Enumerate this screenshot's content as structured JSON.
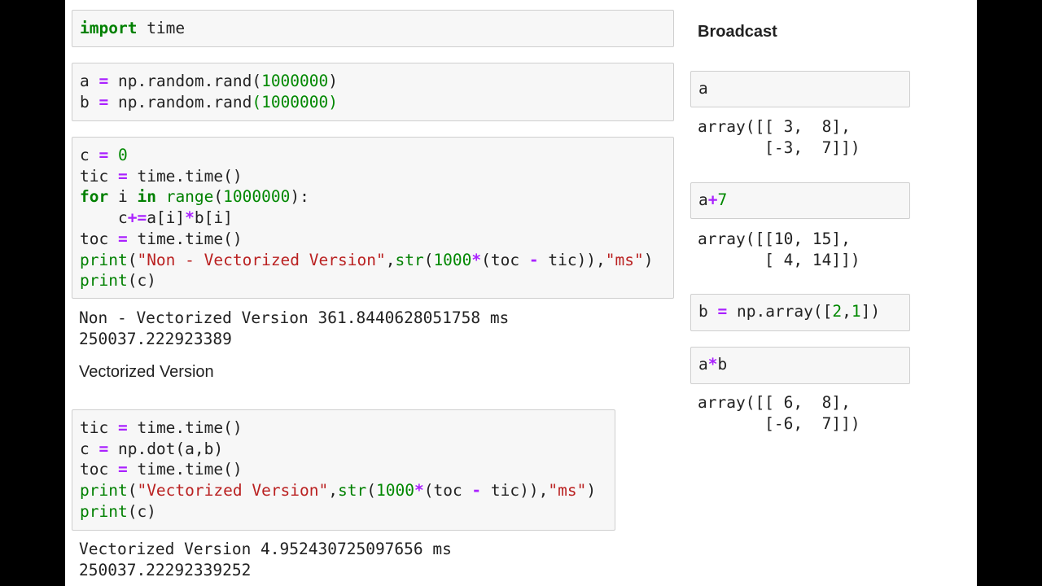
{
  "left": {
    "cells": [
      {
        "lines": [
          [
            [
              "import",
              "kw"
            ],
            [
              " time",
              ""
            ]
          ]
        ]
      },
      {
        "lines": [
          [
            [
              "a ",
              ""
            ],
            [
              "=",
              "op"
            ],
            [
              " np.random.rand(",
              ""
            ],
            [
              "1000000",
              "num"
            ],
            [
              ")",
              ""
            ]
          ],
          [
            [
              "b ",
              ""
            ],
            [
              "=",
              "op"
            ],
            [
              " np.random.rand",
              ""
            ],
            [
              "(1000000)",
              "num"
            ]
          ]
        ]
      },
      {
        "lines": [
          [
            [
              "c ",
              ""
            ],
            [
              "=",
              "op"
            ],
            [
              " ",
              ""
            ],
            [
              "0",
              "num"
            ]
          ],
          [
            [
              "tic ",
              ""
            ],
            [
              "=",
              "op"
            ],
            [
              " time.time()",
              ""
            ]
          ],
          [
            [
              "for",
              "kw"
            ],
            [
              " i ",
              ""
            ],
            [
              "in",
              "kw"
            ],
            [
              " ",
              ""
            ],
            [
              "range",
              "bi"
            ],
            [
              "(",
              ""
            ],
            [
              "1000000",
              "num"
            ],
            [
              "):",
              ""
            ]
          ],
          [
            [
              "    c",
              ""
            ],
            [
              "+=",
              "op"
            ],
            [
              "a[i]",
              ""
            ],
            [
              "*",
              "op"
            ],
            [
              "b[i]",
              ""
            ]
          ],
          [
            [
              "toc ",
              ""
            ],
            [
              "=",
              "op"
            ],
            [
              " time.time()",
              ""
            ]
          ],
          [
            [
              "print",
              "bi"
            ],
            [
              "(",
              ""
            ],
            [
              "\"Non - Vectorized Version\"",
              "str"
            ],
            [
              ",",
              ""
            ],
            [
              "str",
              "bi"
            ],
            [
              "(",
              ""
            ],
            [
              "1000",
              "num"
            ],
            [
              "*",
              "op"
            ],
            [
              "(toc ",
              ""
            ],
            [
              "-",
              "op"
            ],
            [
              " tic)),",
              ""
            ],
            [
              "\"ms\"",
              "str"
            ],
            [
              ")",
              ""
            ]
          ],
          [
            [
              "print",
              "bi"
            ],
            [
              "(c)",
              ""
            ]
          ]
        ]
      },
      {
        "lines": [
          [
            [
              "tic ",
              ""
            ],
            [
              "=",
              "op"
            ],
            [
              " time.time()",
              ""
            ]
          ],
          [
            [
              "c ",
              ""
            ],
            [
              "=",
              "op"
            ],
            [
              " np.dot(a,b)",
              ""
            ]
          ],
          [
            [
              "toc ",
              ""
            ],
            [
              "=",
              "op"
            ],
            [
              " time.time()",
              ""
            ]
          ],
          [
            [
              "print",
              "bi"
            ],
            [
              "(",
              ""
            ],
            [
              "\"Vectorized Version\"",
              "str"
            ],
            [
              ",",
              ""
            ],
            [
              "str",
              "bi"
            ],
            [
              "(",
              ""
            ],
            [
              "1000",
              "num"
            ],
            [
              "*",
              "op"
            ],
            [
              "(toc ",
              ""
            ],
            [
              "-",
              "op"
            ],
            [
              " tic)),",
              ""
            ],
            [
              "\"ms\"",
              "str"
            ],
            [
              ")",
              ""
            ]
          ],
          [
            [
              "print",
              "bi"
            ],
            [
              "(c)",
              ""
            ]
          ]
        ]
      }
    ],
    "output1": "Non - Vectorized Version 361.8440628051758 ms\n250037.222923389",
    "markdown": "Vectorized Version",
    "output2": "Vectorized Version 4.952430725097656 ms\n250037.22292339252"
  },
  "right": {
    "heading": "Broadcast",
    "cells": [
      {
        "lines": [
          [
            [
              "a",
              ""
            ]
          ]
        ]
      },
      {
        "lines": [
          [
            [
              "a",
              ""
            ],
            [
              "+",
              "op"
            ],
            [
              "7",
              "num"
            ]
          ]
        ]
      },
      {
        "lines": [
          [
            [
              "b ",
              ""
            ],
            [
              "=",
              "op"
            ],
            [
              " np.array([",
              ""
            ],
            [
              "2",
              "num"
            ],
            [
              ",",
              ""
            ],
            [
              "1",
              "num"
            ],
            [
              "])",
              ""
            ]
          ]
        ]
      },
      {
        "lines": [
          [
            [
              "a",
              ""
            ],
            [
              "*",
              "op"
            ],
            [
              "b",
              ""
            ]
          ]
        ]
      }
    ],
    "outputs": [
      "array([[ 3,  8],\n       [-3,  7]])",
      "array([[10, 15],\n       [ 4, 14]])",
      "array([[ 6,  8],\n       [-6,  7]])"
    ]
  }
}
